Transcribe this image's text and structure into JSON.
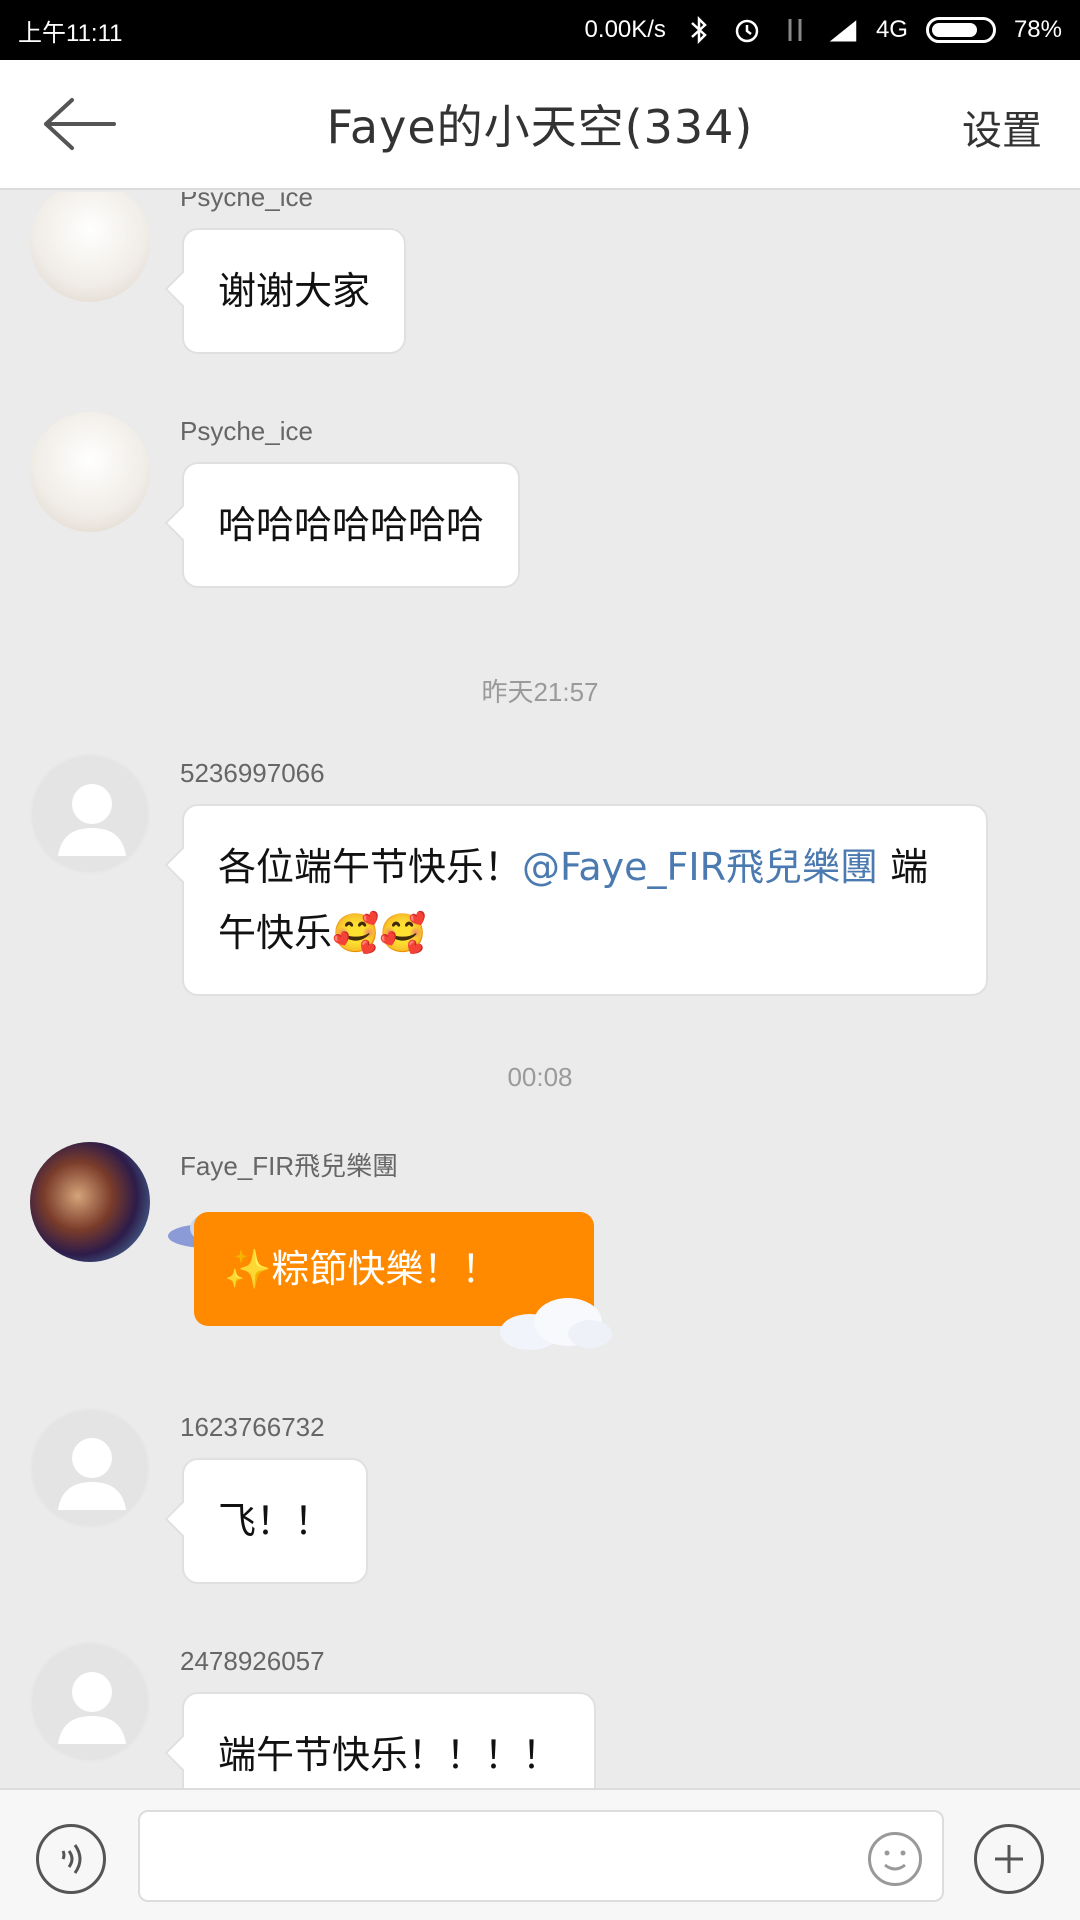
{
  "status": {
    "time": "上午11:11",
    "speed": "0.00K/s",
    "network": "4G",
    "battery": "78%",
    "battery_level": 0.78
  },
  "header": {
    "back_icon": "arrow-left-icon",
    "title": "Faye的小天空(334)",
    "settings_label": "设置"
  },
  "messages": [
    {
      "sender": "Psyche_ice",
      "text": "谢谢大家",
      "avatar": "photo"
    },
    {
      "sender": "Psyche_ice",
      "text": "哈哈哈哈哈哈哈",
      "avatar": "photo"
    },
    {
      "timestamp": "昨天21:57"
    },
    {
      "sender": "5236997066",
      "text_prefix": "各位端午节快乐！",
      "mention": "@Faye_FIR飛兒樂團",
      "text_suffix": " 端午快乐🥰🥰",
      "avatar": "default"
    },
    {
      "timestamp": "00:08"
    },
    {
      "sender": "Faye_FIR飛兒樂團",
      "text": "✨粽節快樂！！",
      "avatar": "photo",
      "style": "special"
    },
    {
      "sender": "1623766732",
      "text": "飞！！",
      "avatar": "default"
    },
    {
      "sender": "2478926057",
      "text": "端午节快乐！！！！",
      "avatar": "default"
    }
  ],
  "input": {
    "value": "",
    "placeholder": "",
    "voice_icon": "voice-icon",
    "emoji_icon": "emoji-icon",
    "plus_icon": "plus-icon"
  },
  "colors": {
    "accent": "#ff8a00",
    "mention": "#4a7ab0",
    "background": "#ebebeb"
  }
}
